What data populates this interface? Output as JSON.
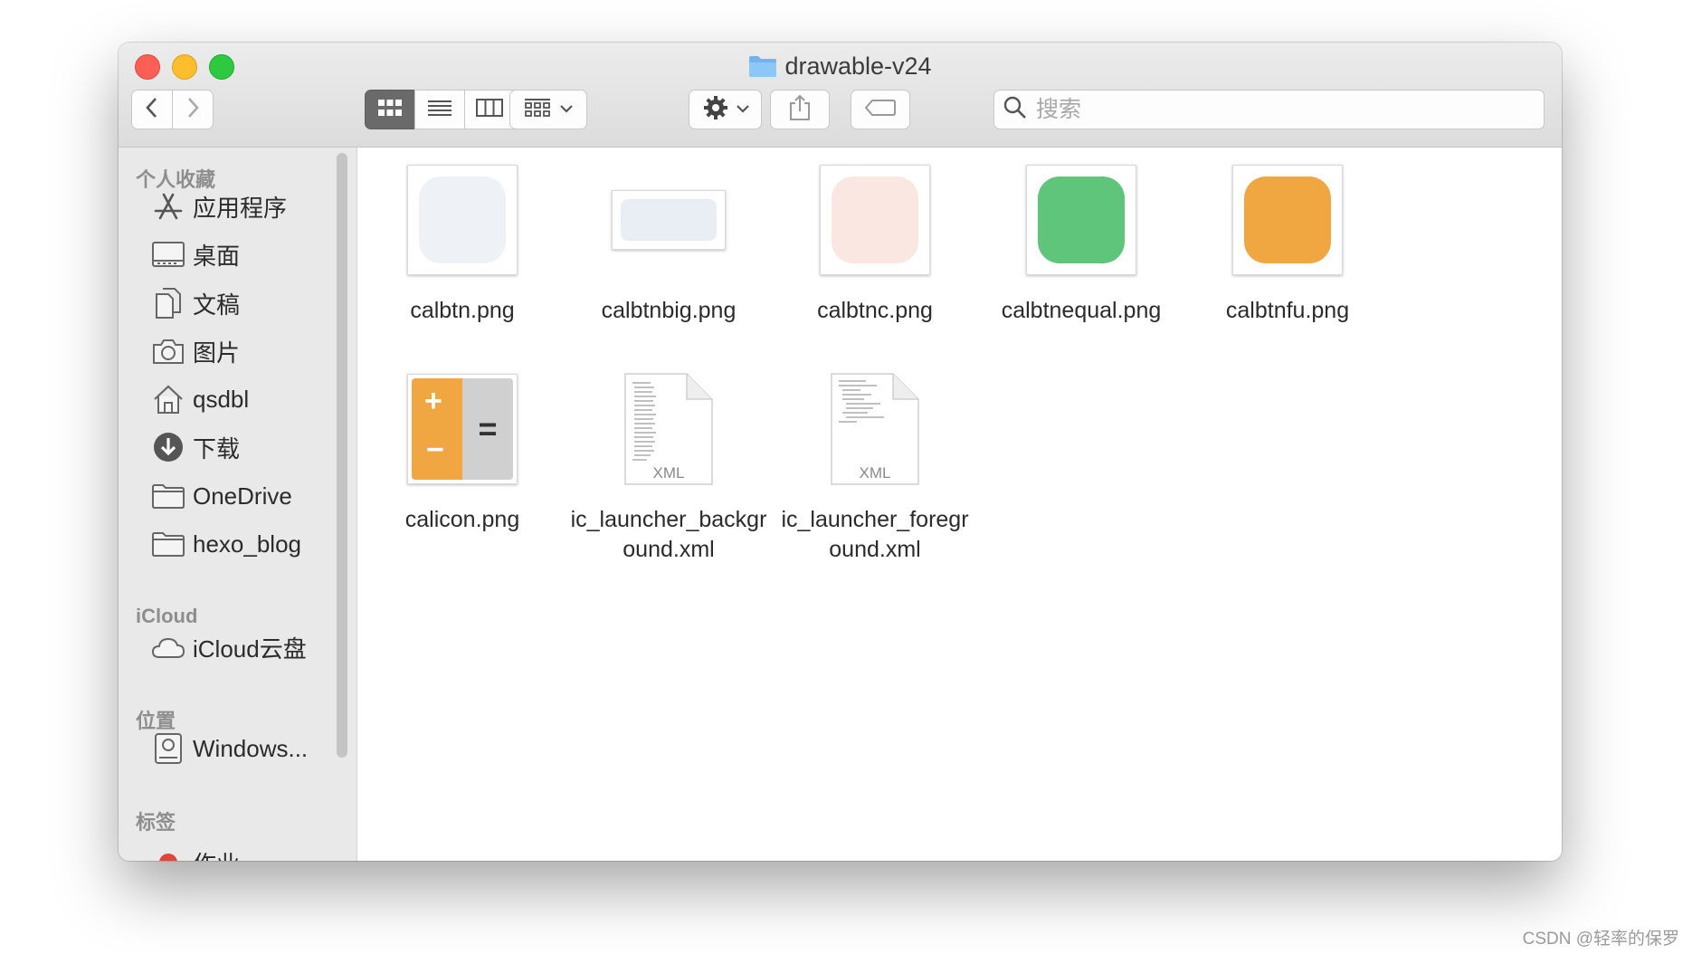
{
  "window": {
    "title": "drawable-v24"
  },
  "toolbar": {
    "back_icon": "chevron-left-icon",
    "forward_icon": "chevron-right-icon",
    "view_modes": [
      "icon-view",
      "list-view",
      "column-view",
      "gallery-view"
    ],
    "active_view": "icon-view",
    "group_icon": "group-grid-icon",
    "action_icon": "gear-icon",
    "share_icon": "share-icon",
    "tag_icon": "tag-icon",
    "search_placeholder": "搜索"
  },
  "sidebar": {
    "sections": [
      {
        "header": "个人收藏",
        "items": [
          {
            "label": "应用程序",
            "icon": "applications-icon"
          },
          {
            "label": "桌面",
            "icon": "desktop-icon"
          },
          {
            "label": "文稿",
            "icon": "documents-icon"
          },
          {
            "label": "图片",
            "icon": "camera-icon"
          },
          {
            "label": "qsdbl",
            "icon": "home-icon"
          },
          {
            "label": "下载",
            "icon": "download-icon"
          },
          {
            "label": "OneDrive",
            "icon": "folder-icon"
          },
          {
            "label": "hexo_blog",
            "icon": "folder-icon"
          }
        ]
      },
      {
        "header": "iCloud",
        "items": [
          {
            "label": "iCloud云盘",
            "icon": "cloud-icon"
          }
        ]
      },
      {
        "header": "位置",
        "items": [
          {
            "label": "Windows...",
            "icon": "disk-icon"
          }
        ]
      },
      {
        "header": "标签",
        "items": [
          {
            "label": "作业",
            "icon": "tag-red-icon"
          }
        ]
      }
    ]
  },
  "files": [
    {
      "name": "calbtn.png",
      "kind": "image",
      "color": "#eef1f6"
    },
    {
      "name": "calbtnbig.png",
      "kind": "image-wide",
      "color": "#e9eef5"
    },
    {
      "name": "calbtnc.png",
      "kind": "image",
      "color": "#fbe7e2"
    },
    {
      "name": "calbtnequal.png",
      "kind": "image",
      "color": "#5fc57a"
    },
    {
      "name": "calbtnfu.png",
      "kind": "image",
      "color": "#f0a742"
    },
    {
      "name": "calicon.png",
      "kind": "calc-icon",
      "color": "#f0a742"
    },
    {
      "name": "ic_launcher_background.xml",
      "kind": "xml"
    },
    {
      "name": "ic_launcher_foreground.xml",
      "kind": "xml"
    }
  ],
  "xml_badge": "XML",
  "calc_symbols": {
    "plus": "+",
    "minus": "−",
    "equals": "="
  },
  "watermark": "CSDN @轻率的保罗"
}
